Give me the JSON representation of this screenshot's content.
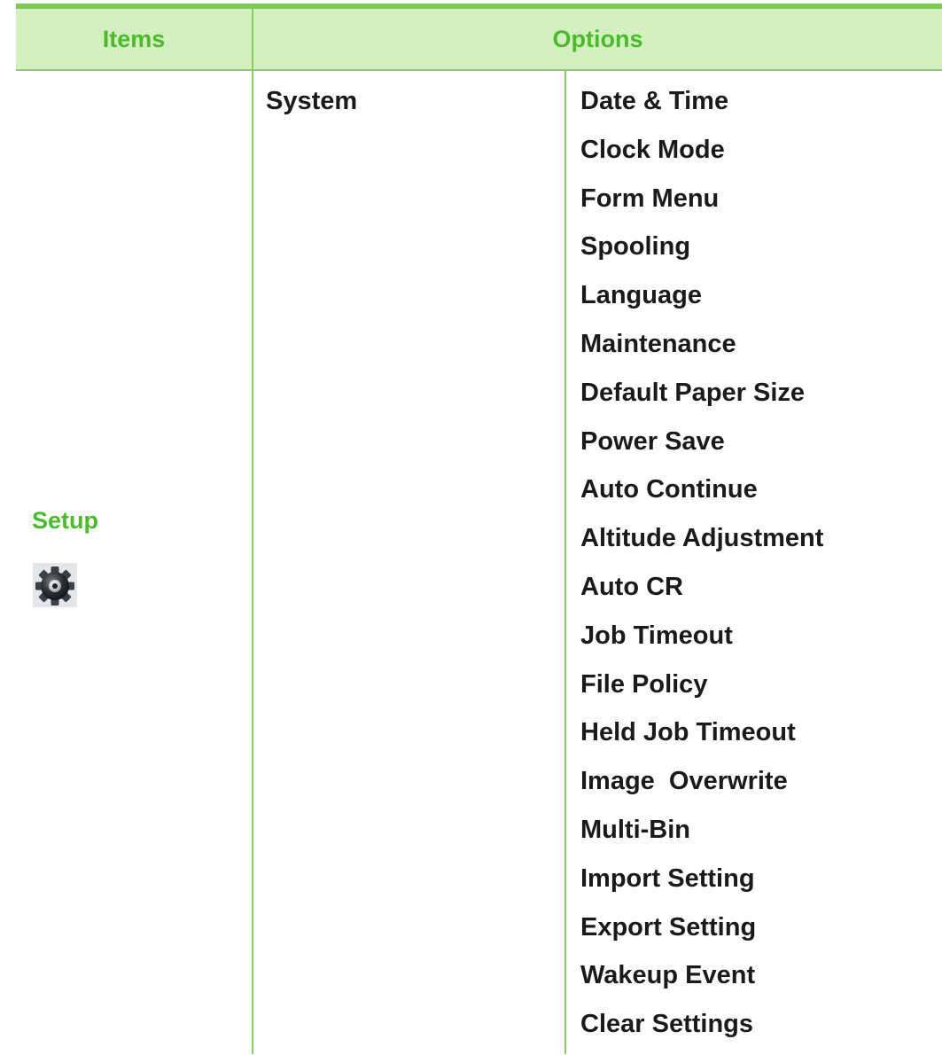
{
  "header": {
    "items_label": "Items",
    "options_label": "Options"
  },
  "item": {
    "label": "Setup",
    "icon": "gear-icon"
  },
  "category": {
    "label": "System"
  },
  "options": [
    "Date & Time",
    "Clock Mode",
    "Form Menu",
    "Spooling",
    "Language",
    "Maintenance",
    "Default Paper Size",
    "Power Save",
    "Auto Continue",
    "Altitude Adjustment",
    "Auto CR",
    "Job Timeout",
    "File Policy",
    "Held Job Timeout",
    "Image  Overwrite",
    "Multi-Bin",
    "Import Setting",
    "Export Setting",
    "Wakeup Event",
    "Clear Settings"
  ],
  "colors": {
    "header_background": "#d4f0c0",
    "header_text": "#4cba2d",
    "rule": "#7ec857",
    "body_text": "#1a1a1a"
  }
}
